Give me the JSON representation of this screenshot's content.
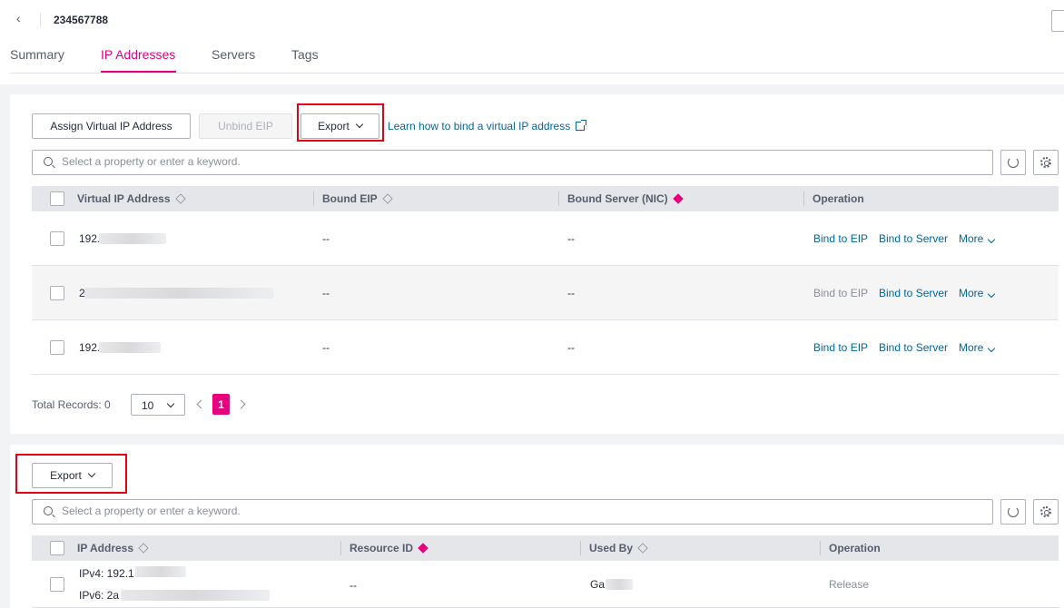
{
  "header": {
    "title": "234567788"
  },
  "tabs": [
    {
      "label": "Summary"
    },
    {
      "label": "IP Addresses"
    },
    {
      "label": "Servers"
    },
    {
      "label": "Tags"
    }
  ],
  "active_tab": "IP Addresses",
  "vip_section": {
    "toolbar": {
      "assign_label": "Assign Virtual IP Address",
      "unbind_label": "Unbind EIP",
      "export_label": "Export",
      "learn_link": "Learn how to bind a virtual IP address"
    },
    "search": {
      "placeholder": "Select a property or enter a keyword."
    },
    "columns": [
      "Virtual IP Address",
      "Bound EIP",
      "Bound Server (NIC)",
      "Operation"
    ],
    "rows": [
      {
        "ip": "192.",
        "eip": "--",
        "server": "--",
        "ops": [
          "Bind to EIP",
          "Bind to Server",
          "More"
        ],
        "eip_enabled": true
      },
      {
        "ip": "2",
        "eip": "--",
        "server": "--",
        "ops": [
          "Bind to EIP",
          "Bind to Server",
          "More"
        ],
        "eip_enabled": false
      },
      {
        "ip": "192.",
        "eip": "--",
        "server": "--",
        "ops": [
          "Bind to EIP",
          "Bind to Server",
          "More"
        ],
        "eip_enabled": true
      }
    ],
    "pager": {
      "total": "Total Records: 0",
      "page_size": "10",
      "page": "1"
    }
  },
  "ip_section": {
    "toolbar": {
      "export_label": "Export"
    },
    "search": {
      "placeholder": "Select a property or enter a keyword."
    },
    "columns": [
      "IP Address",
      "Resource ID",
      "Used By",
      "Operation"
    ],
    "rows": [
      {
        "ipv4": "IPv4: 192.1",
        "ipv6": "IPv6: 2a",
        "resource_id": "--",
        "used_by": "Ga",
        "op": "Release"
      }
    ]
  },
  "colors": {
    "accent": "#e6007e",
    "link": "#0066a3",
    "highlight": "#e60012"
  }
}
